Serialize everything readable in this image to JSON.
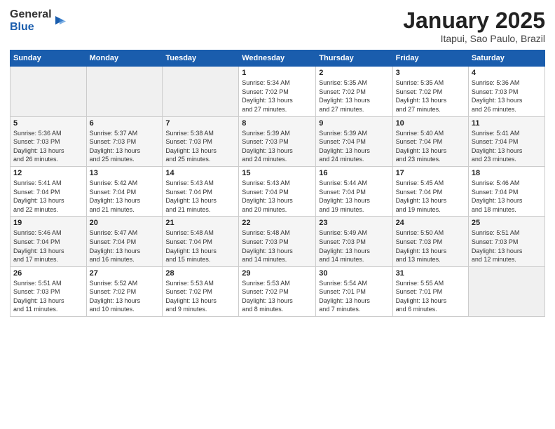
{
  "logo": {
    "general": "General",
    "blue": "Blue"
  },
  "title": "January 2025",
  "location": "Itapui, Sao Paulo, Brazil",
  "weekdays": [
    "Sunday",
    "Monday",
    "Tuesday",
    "Wednesday",
    "Thursday",
    "Friday",
    "Saturday"
  ],
  "weeks": [
    [
      {
        "day": "",
        "info": ""
      },
      {
        "day": "",
        "info": ""
      },
      {
        "day": "",
        "info": ""
      },
      {
        "day": "1",
        "info": "Sunrise: 5:34 AM\nSunset: 7:02 PM\nDaylight: 13 hours\nand 27 minutes."
      },
      {
        "day": "2",
        "info": "Sunrise: 5:35 AM\nSunset: 7:02 PM\nDaylight: 13 hours\nand 27 minutes."
      },
      {
        "day": "3",
        "info": "Sunrise: 5:35 AM\nSunset: 7:02 PM\nDaylight: 13 hours\nand 27 minutes."
      },
      {
        "day": "4",
        "info": "Sunrise: 5:36 AM\nSunset: 7:03 PM\nDaylight: 13 hours\nand 26 minutes."
      }
    ],
    [
      {
        "day": "5",
        "info": "Sunrise: 5:36 AM\nSunset: 7:03 PM\nDaylight: 13 hours\nand 26 minutes."
      },
      {
        "day": "6",
        "info": "Sunrise: 5:37 AM\nSunset: 7:03 PM\nDaylight: 13 hours\nand 25 minutes."
      },
      {
        "day": "7",
        "info": "Sunrise: 5:38 AM\nSunset: 7:03 PM\nDaylight: 13 hours\nand 25 minutes."
      },
      {
        "day": "8",
        "info": "Sunrise: 5:39 AM\nSunset: 7:03 PM\nDaylight: 13 hours\nand 24 minutes."
      },
      {
        "day": "9",
        "info": "Sunrise: 5:39 AM\nSunset: 7:04 PM\nDaylight: 13 hours\nand 24 minutes."
      },
      {
        "day": "10",
        "info": "Sunrise: 5:40 AM\nSunset: 7:04 PM\nDaylight: 13 hours\nand 23 minutes."
      },
      {
        "day": "11",
        "info": "Sunrise: 5:41 AM\nSunset: 7:04 PM\nDaylight: 13 hours\nand 23 minutes."
      }
    ],
    [
      {
        "day": "12",
        "info": "Sunrise: 5:41 AM\nSunset: 7:04 PM\nDaylight: 13 hours\nand 22 minutes."
      },
      {
        "day": "13",
        "info": "Sunrise: 5:42 AM\nSunset: 7:04 PM\nDaylight: 13 hours\nand 21 minutes."
      },
      {
        "day": "14",
        "info": "Sunrise: 5:43 AM\nSunset: 7:04 PM\nDaylight: 13 hours\nand 21 minutes."
      },
      {
        "day": "15",
        "info": "Sunrise: 5:43 AM\nSunset: 7:04 PM\nDaylight: 13 hours\nand 20 minutes."
      },
      {
        "day": "16",
        "info": "Sunrise: 5:44 AM\nSunset: 7:04 PM\nDaylight: 13 hours\nand 19 minutes."
      },
      {
        "day": "17",
        "info": "Sunrise: 5:45 AM\nSunset: 7:04 PM\nDaylight: 13 hours\nand 19 minutes."
      },
      {
        "day": "18",
        "info": "Sunrise: 5:46 AM\nSunset: 7:04 PM\nDaylight: 13 hours\nand 18 minutes."
      }
    ],
    [
      {
        "day": "19",
        "info": "Sunrise: 5:46 AM\nSunset: 7:04 PM\nDaylight: 13 hours\nand 17 minutes."
      },
      {
        "day": "20",
        "info": "Sunrise: 5:47 AM\nSunset: 7:04 PM\nDaylight: 13 hours\nand 16 minutes."
      },
      {
        "day": "21",
        "info": "Sunrise: 5:48 AM\nSunset: 7:04 PM\nDaylight: 13 hours\nand 15 minutes."
      },
      {
        "day": "22",
        "info": "Sunrise: 5:48 AM\nSunset: 7:03 PM\nDaylight: 13 hours\nand 14 minutes."
      },
      {
        "day": "23",
        "info": "Sunrise: 5:49 AM\nSunset: 7:03 PM\nDaylight: 13 hours\nand 14 minutes."
      },
      {
        "day": "24",
        "info": "Sunrise: 5:50 AM\nSunset: 7:03 PM\nDaylight: 13 hours\nand 13 minutes."
      },
      {
        "day": "25",
        "info": "Sunrise: 5:51 AM\nSunset: 7:03 PM\nDaylight: 13 hours\nand 12 minutes."
      }
    ],
    [
      {
        "day": "26",
        "info": "Sunrise: 5:51 AM\nSunset: 7:03 PM\nDaylight: 13 hours\nand 11 minutes."
      },
      {
        "day": "27",
        "info": "Sunrise: 5:52 AM\nSunset: 7:02 PM\nDaylight: 13 hours\nand 10 minutes."
      },
      {
        "day": "28",
        "info": "Sunrise: 5:53 AM\nSunset: 7:02 PM\nDaylight: 13 hours\nand 9 minutes."
      },
      {
        "day": "29",
        "info": "Sunrise: 5:53 AM\nSunset: 7:02 PM\nDaylight: 13 hours\nand 8 minutes."
      },
      {
        "day": "30",
        "info": "Sunrise: 5:54 AM\nSunset: 7:01 PM\nDaylight: 13 hours\nand 7 minutes."
      },
      {
        "day": "31",
        "info": "Sunrise: 5:55 AM\nSunset: 7:01 PM\nDaylight: 13 hours\nand 6 minutes."
      },
      {
        "day": "",
        "info": ""
      }
    ]
  ]
}
